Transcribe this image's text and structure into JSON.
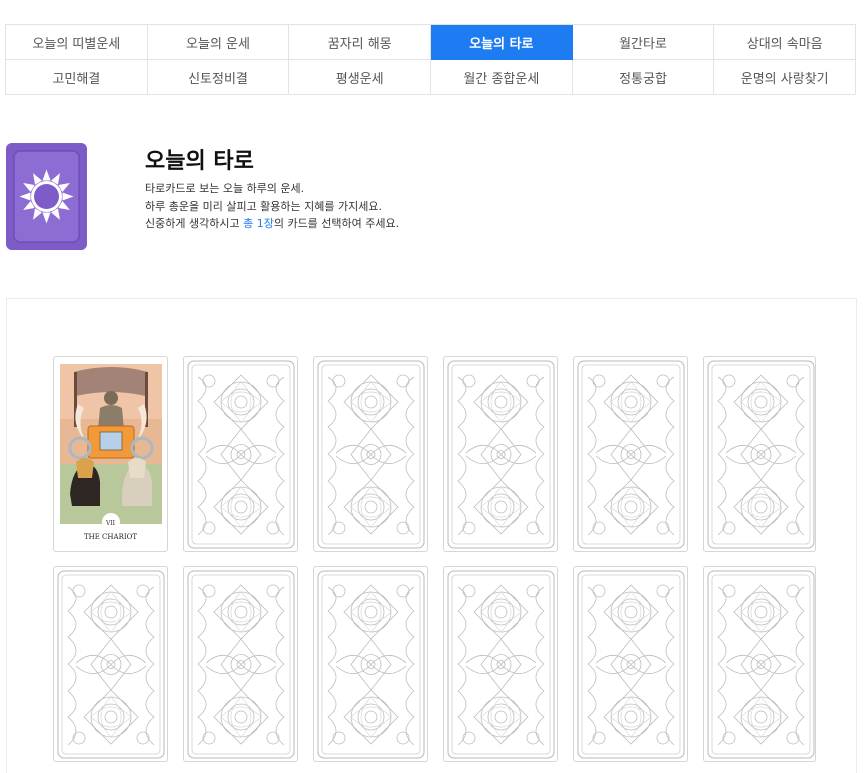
{
  "nav": {
    "row1": [
      "오늘의 띠별운세",
      "오늘의 운세",
      "꿈자리 해몽",
      "오늘의 타로",
      "월간타로",
      "상대의 속마음"
    ],
    "row2": [
      "고민해결",
      "신토정비결",
      "평생운세",
      "월간 종합운세",
      "정통궁합",
      "운명의 사랑찾기"
    ],
    "active": "오늘의 타로"
  },
  "header": {
    "icon": "sun-tarot-icon",
    "title": "오늘의 타로",
    "line1": "타로카드로 보는 오늘 하루의 운세.",
    "line2": "하루 총운을 미리 살피고 활용하는 지혜를 가지세요.",
    "line3_pre": "신중하게 생각하시고 ",
    "line3_highlight": "총 1장",
    "line3_post": "의 카드를 선택하여 주세요.",
    "highlight_color": "#1e7cf2"
  },
  "cards": {
    "revealed": {
      "numeral": "VII",
      "name": "THE CHARIOT"
    },
    "total": 12,
    "face_down_pattern": "mandala-card-back-icon"
  },
  "colors": {
    "accent": "#1e7cf2",
    "icon_bg": "#7e5cc7"
  }
}
